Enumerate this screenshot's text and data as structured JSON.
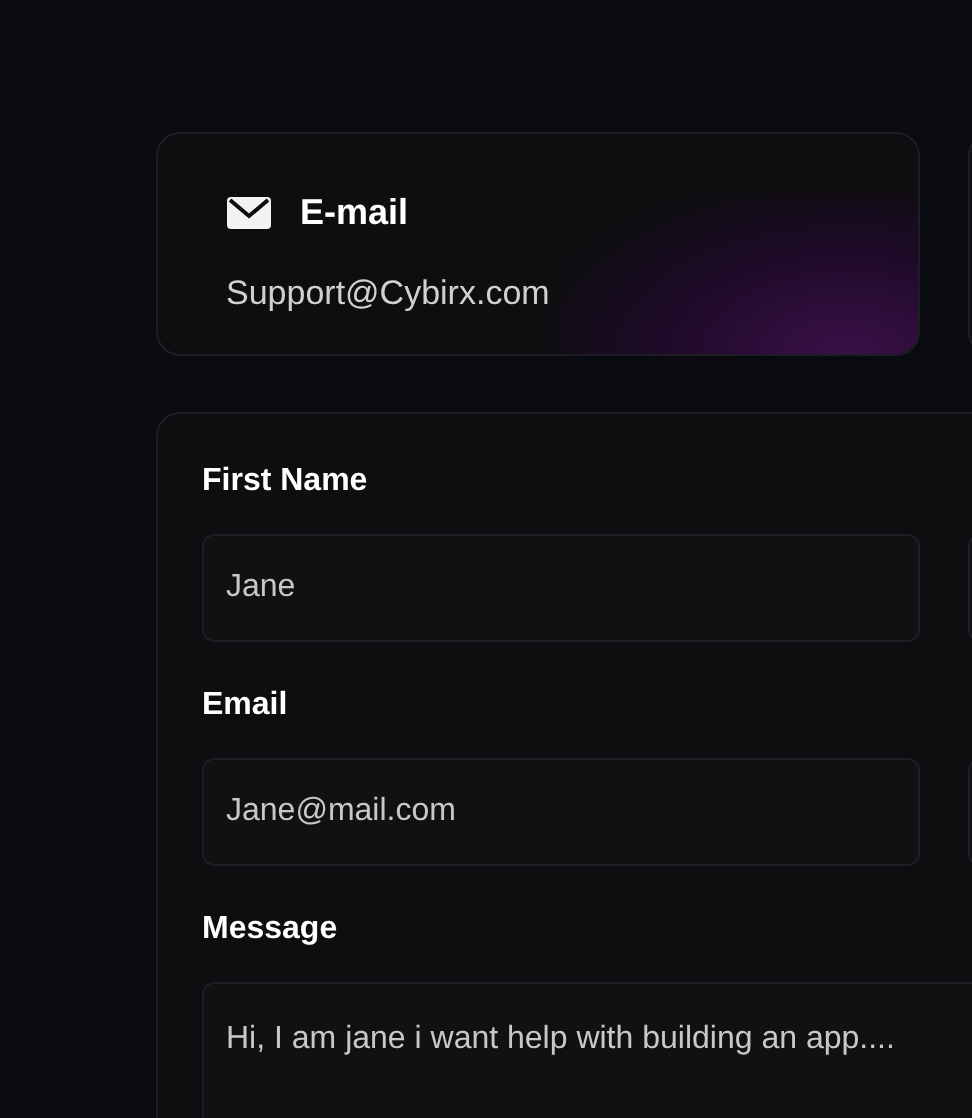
{
  "contact_card": {
    "title": "E-mail",
    "detail": "Support@Cybirx.com"
  },
  "form": {
    "fields": [
      {
        "label": "First Name",
        "value": "Jane"
      },
      {
        "label": "Email",
        "value": "Jane@mail.com"
      }
    ],
    "message": {
      "label": "Message",
      "value": "Hi, I am jane i want help with building an app...."
    }
  }
}
